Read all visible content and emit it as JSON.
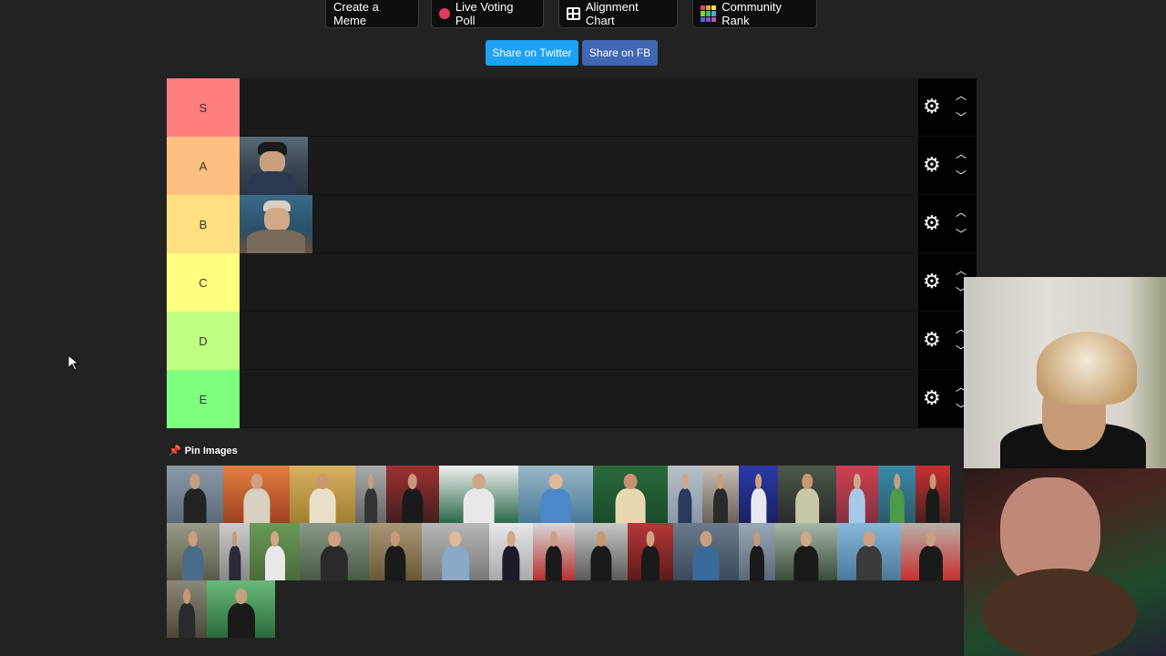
{
  "nav": {
    "create_meme": "Create a Meme",
    "live_poll": "Live Voting Poll",
    "alignment": "Alignment Chart",
    "community": "Community Rank"
  },
  "share": {
    "twitter": "Share on Twitter",
    "fb": "Share on FB"
  },
  "colors": {
    "twitter": "#1da1f2",
    "fb": "#4267b2",
    "background": "#232223"
  },
  "tiers": [
    {
      "label": "S",
      "color": "#ff7f7f"
    },
    {
      "label": "A",
      "color": "#ffbf7f"
    },
    {
      "label": "B",
      "color": "#ffdf7f"
    },
    {
      "label": "C",
      "color": "#ffff7f"
    },
    {
      "label": "D",
      "color": "#bfff7f"
    },
    {
      "label": "E",
      "color": "#7fff7f"
    }
  ],
  "pin_images": "Pin Images",
  "icons": {
    "settings": "gear-icon",
    "move_up": "chevron-up-icon",
    "move_down": "chevron-down-icon",
    "pin": "pin-icon",
    "poll": "red-dot-icon",
    "alignment": "grid-icon",
    "community": "color-grid-icon"
  }
}
